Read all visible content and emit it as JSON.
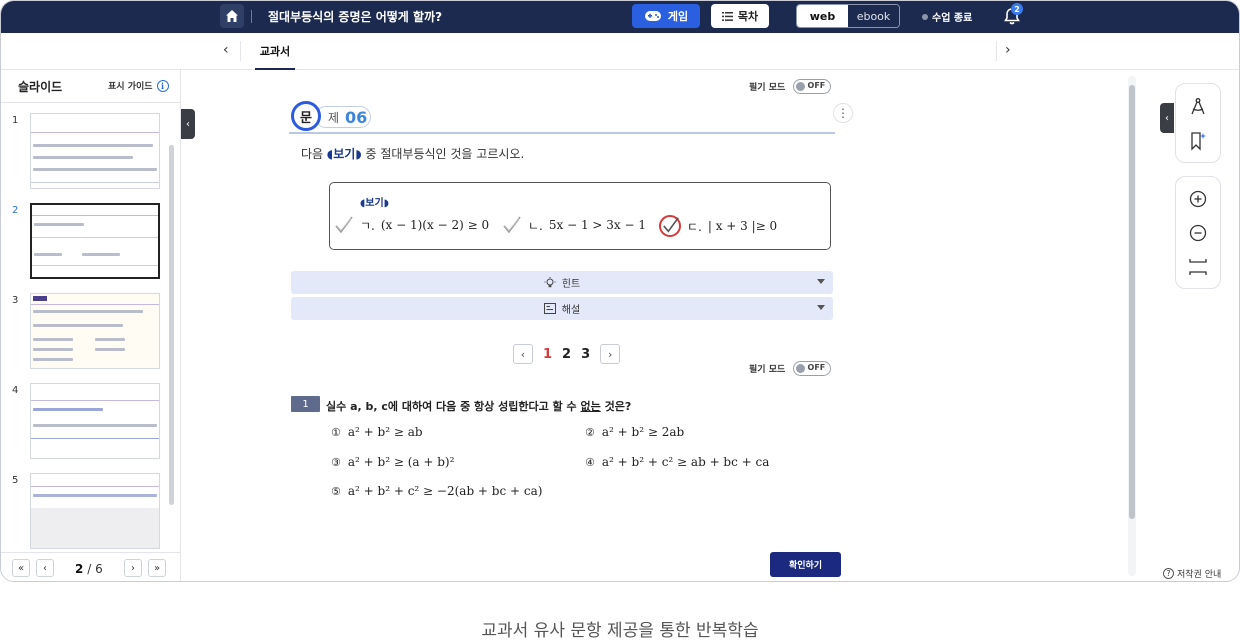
{
  "header": {
    "title": "절대부등식의 증명은 어떻게 할까?",
    "game_label": "게임",
    "toc_label": "목차",
    "mode_web": "web",
    "mode_ebook": "ebook",
    "end_class_label": "수업 종료",
    "notification_count": "2"
  },
  "tabs": {
    "active": "교과서"
  },
  "sidebar": {
    "title": "슬라이드",
    "guide_label": "표시 가이드",
    "slides": [
      "1",
      "2",
      "3",
      "4",
      "5"
    ],
    "pager": {
      "current": "2",
      "sep": "/",
      "total": "6"
    }
  },
  "main": {
    "note_mode_label": "필기 모드",
    "toggle_off": "OFF",
    "problem_prefix": "문",
    "problem_suffix": "제",
    "problem_number": "06",
    "prompt_before": "다음",
    "prompt_tag": "◖보기◗",
    "prompt_after": "중 절대부등식인 것을 고르시오.",
    "bogi_title": "◖보기◗",
    "bogi_options": [
      {
        "label": "ㄱ.",
        "expr": "(x − 1)(x − 2) ≥ 0"
      },
      {
        "label": "ㄴ.",
        "expr": "5x − 1 > 3x − 1"
      },
      {
        "label": "ㄷ.",
        "expr": "| x + 3 |≥ 0"
      }
    ],
    "hint_label": "힌트",
    "explain_label": "해설",
    "pages": [
      "1",
      "2",
      "3"
    ],
    "current_page": "1",
    "question": {
      "number": "1",
      "text_before": "실수 a, b, c에 대하여 다음 중 항상 성립한다고 할 수",
      "text_underlined": "없는",
      "text_after": "것은?",
      "choices": [
        {
          "num": "①",
          "expr": "a² + b² ≥ ab"
        },
        {
          "num": "②",
          "expr": "a² + b² ≥ 2ab"
        },
        {
          "num": "③",
          "expr": "a² + b² ≥ (a + b)²"
        },
        {
          "num": "④",
          "expr": "a² + b² + c² ≥ ab + bc + ca"
        },
        {
          "num": "⑤",
          "expr": "a² + b² + c² ≥ −2(ab + bc + ca)"
        }
      ]
    },
    "confirm_label": "확인하기"
  },
  "footer": {
    "copyright_label": "저작권 안내",
    "caption": "교과서 유사 문항 제공을 통한 반복학습"
  },
  "colors": {
    "header_bg": "#1b2a4e",
    "accent_blue": "#2a5fe0",
    "confirm": "#1b2a7e",
    "highlight_red": "#d63a3a"
  },
  "icons": [
    "home-icon",
    "gamepad-icon",
    "list-icon",
    "bell-icon",
    "info-icon",
    "bulb-icon",
    "note-icon",
    "compass-icon",
    "bookmark-star-icon",
    "zoom-in-icon",
    "zoom-out-icon",
    "fit-height-icon",
    "check-icon",
    "help-icon"
  ]
}
